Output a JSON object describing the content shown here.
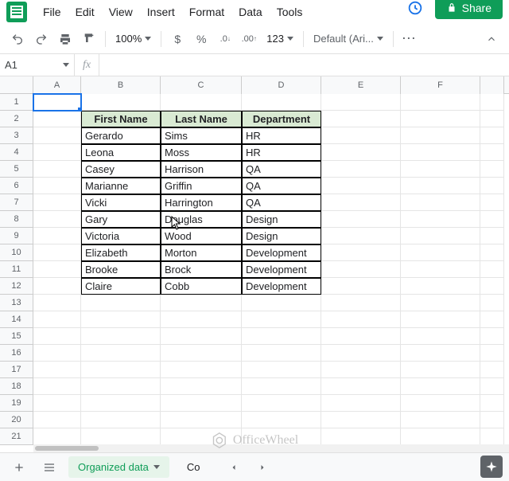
{
  "menubar": {
    "file": "File",
    "edit": "Edit",
    "view": "View",
    "insert": "Insert",
    "format": "Format",
    "data": "Data",
    "tools": "Tools"
  },
  "share_label": "Share",
  "toolbar": {
    "zoom": "100%",
    "currency": "$",
    "percent": "%",
    "dec_dec": ".0",
    "inc_dec": ".00",
    "numfmt": "123",
    "font": "Default (Ari...",
    "more": "⋯"
  },
  "namebox": "A1",
  "fx": "fx",
  "columns": [
    "A",
    "B",
    "C",
    "D",
    "E",
    "F",
    ""
  ],
  "rownums": [
    "1",
    "2",
    "3",
    "4",
    "5",
    "6",
    "7",
    "8",
    "9",
    "10",
    "11",
    "12",
    "13",
    "14",
    "15",
    "16",
    "17",
    "18",
    "19",
    "20",
    "21"
  ],
  "headers": {
    "first": "First Name",
    "last": "Last Name",
    "dept": "Department"
  },
  "rows": [
    {
      "first": "Gerardo",
      "last": "Sims",
      "dept": "HR"
    },
    {
      "first": "Leona",
      "last": "Moss",
      "dept": "HR"
    },
    {
      "first": "Casey",
      "last": "Harrison",
      "dept": "QA"
    },
    {
      "first": "Marianne",
      "last": "Griffin",
      "dept": "QA"
    },
    {
      "first": "Vicki",
      "last": "Harrington",
      "dept": "QA"
    },
    {
      "first": "Gary",
      "last": "Douglas",
      "dept": "Design"
    },
    {
      "first": "Victoria",
      "last": "Wood",
      "dept": "Design"
    },
    {
      "first": "Elizabeth",
      "last": "Morton",
      "dept": "Development"
    },
    {
      "first": "Brooke",
      "last": "Brock",
      "dept": "Development"
    },
    {
      "first": "Claire",
      "last": "Cobb",
      "dept": "Development"
    }
  ],
  "sheets": {
    "active": "Organized data",
    "next_partial": "Co"
  },
  "watermark": "OfficeWheel"
}
